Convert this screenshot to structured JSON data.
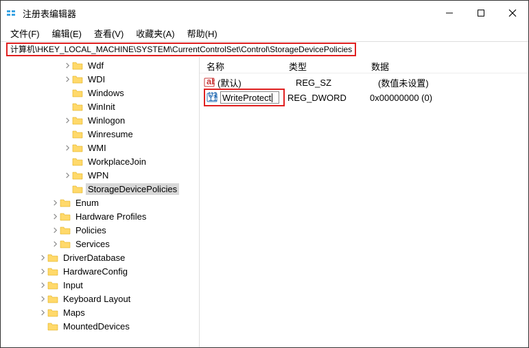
{
  "window": {
    "title": "注册表编辑器"
  },
  "menu": {
    "file": "文件(F)",
    "edit": "编辑(E)",
    "view": "查看(V)",
    "favorites": "收藏夹(A)",
    "help": "帮助(H)"
  },
  "address": {
    "path": "计算机\\HKEY_LOCAL_MACHINE\\SYSTEM\\CurrentControlSet\\Control\\StorageDevicePolicies"
  },
  "tree": {
    "wdf": "Wdf",
    "wdi": "WDI",
    "windows": "Windows",
    "wininit": "WinInit",
    "winlogon": "Winlogon",
    "winresume": "Winresume",
    "wmi": "WMI",
    "workplacejoin": "WorkplaceJoin",
    "wpn": "WPN",
    "storagedevicepolicies": "StorageDevicePolicies",
    "enum": "Enum",
    "hardwareprofiles": "Hardware Profiles",
    "policies": "Policies",
    "services": "Services",
    "driverdatabase": "DriverDatabase",
    "hardwareconfig": "HardwareConfig",
    "input": "Input",
    "keyboardlayout": "Keyboard Layout",
    "maps": "Maps",
    "mounteddevices": "MountedDevices"
  },
  "columns": {
    "name": "名称",
    "type": "类型",
    "data": "数据"
  },
  "values": {
    "default": {
      "name": "(默认)",
      "type": "REG_SZ",
      "data": "(数值未设置)"
    },
    "wp": {
      "name": "WriteProtect",
      "type": "REG_DWORD",
      "data": "0x00000000 (0)"
    }
  }
}
